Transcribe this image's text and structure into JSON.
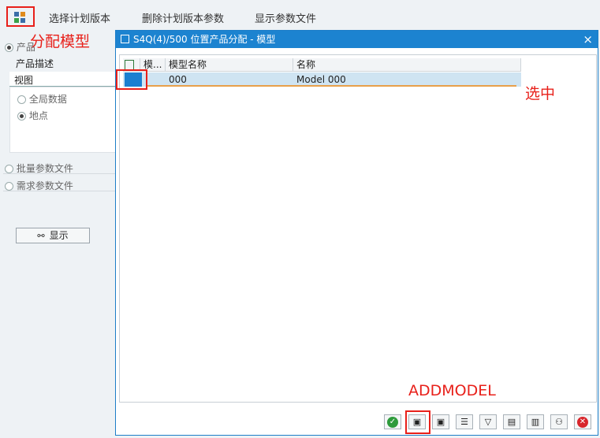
{
  "toolbar": {
    "menu": [
      "选择计划版本",
      "删除计划版本参数",
      "显示参数文件"
    ]
  },
  "annotations": {
    "assign_model": "分配模型",
    "selected": "选中",
    "addmodel": "ADDMODEL"
  },
  "left_panel": {
    "product_radio": "产品",
    "product_desc_label": "产品描述",
    "view_label": "视图",
    "global_data": "全局数据",
    "location": "地点",
    "batch_param_file": "批量参数文件",
    "demand_param_file": "需求参数文件",
    "show_button": "显示"
  },
  "dialog": {
    "title": "S4Q(4)/500 位置产品分配 - 模型",
    "close": "×",
    "columns": [
      "模...",
      "模型名称",
      "名称"
    ],
    "rows": [
      {
        "model_name": "000",
        "name": "Model 000"
      }
    ]
  },
  "colors": {
    "accent": "#1c83d0",
    "annotation_red": "#e8201a",
    "row_highlight": "#cfe4f2"
  }
}
